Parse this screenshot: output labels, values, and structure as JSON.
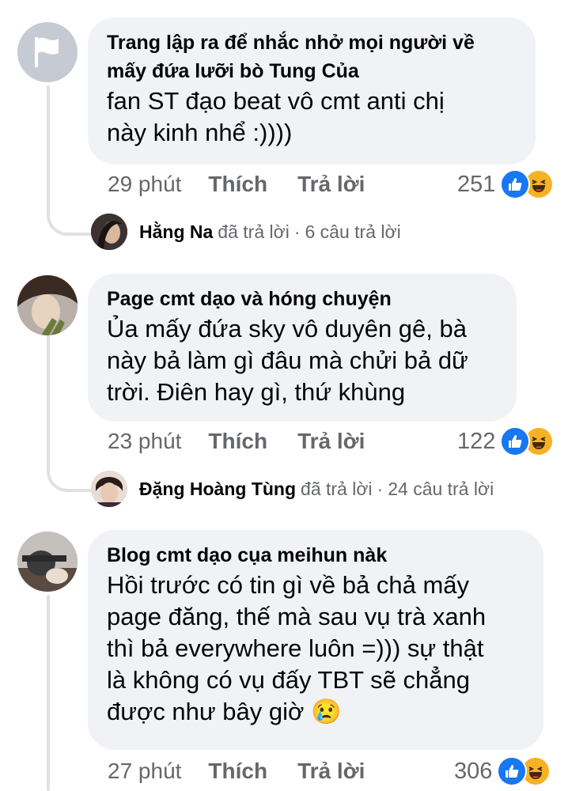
{
  "comments": [
    {
      "author": "Trang lập ra để nhắc nhở mọi người về",
      "author_line2": "mấy đứa lưỡi bò Tung Của",
      "text_lines": [
        "fan ST đạo beat vô cmt anti chị",
        "này kinh nhể :))))"
      ],
      "time": "29 phút",
      "like_label": "Thích",
      "reply_label": "Trả lời",
      "reaction_count": "251",
      "reply_summary": {
        "name": "Hằng Na",
        "action": "đã trả lời",
        "sep": "·",
        "count": "6 câu trả lời"
      }
    },
    {
      "author": "Page cmt dạo và hóng chuyện",
      "text_lines": [
        "Ủa mấy đứa sky vô duyên gê, bà",
        "này bả làm gì đâu mà chửi bả dữ",
        "trời. Điên hay gì, thứ khùng"
      ],
      "time": "23 phút",
      "like_label": "Thích",
      "reply_label": "Trả lời",
      "reaction_count": "122",
      "reply_summary": {
        "name": "Đặng Hoàng Tùng",
        "action": "đã trả lời",
        "sep": "·",
        "count": "24 câu trả lời"
      }
    },
    {
      "author": "Blog cmt dạo cụa meihun nàk",
      "text_lines": [
        "Hồi trước có tin gì về bả chả mấy",
        "page đăng, thế mà sau vụ trà xanh",
        "thì bả everywhere luôn =))) sự thật",
        "là không có vụ đấy TBT sẽ chẳng",
        "được như bây giờ 😢"
      ],
      "time": "27 phút",
      "like_label": "Thích",
      "reply_label": "Trả lời",
      "reaction_count": "306"
    }
  ],
  "icons": {
    "like": "like-reaction-icon",
    "haha": "haha-reaction-icon",
    "page_avatar": "flag-icon"
  },
  "colors": {
    "bubble": "#f0f2f5",
    "like_blue": "#1877f2",
    "haha_yellow": "#f7b125",
    "meta_gray": "#65676b"
  }
}
